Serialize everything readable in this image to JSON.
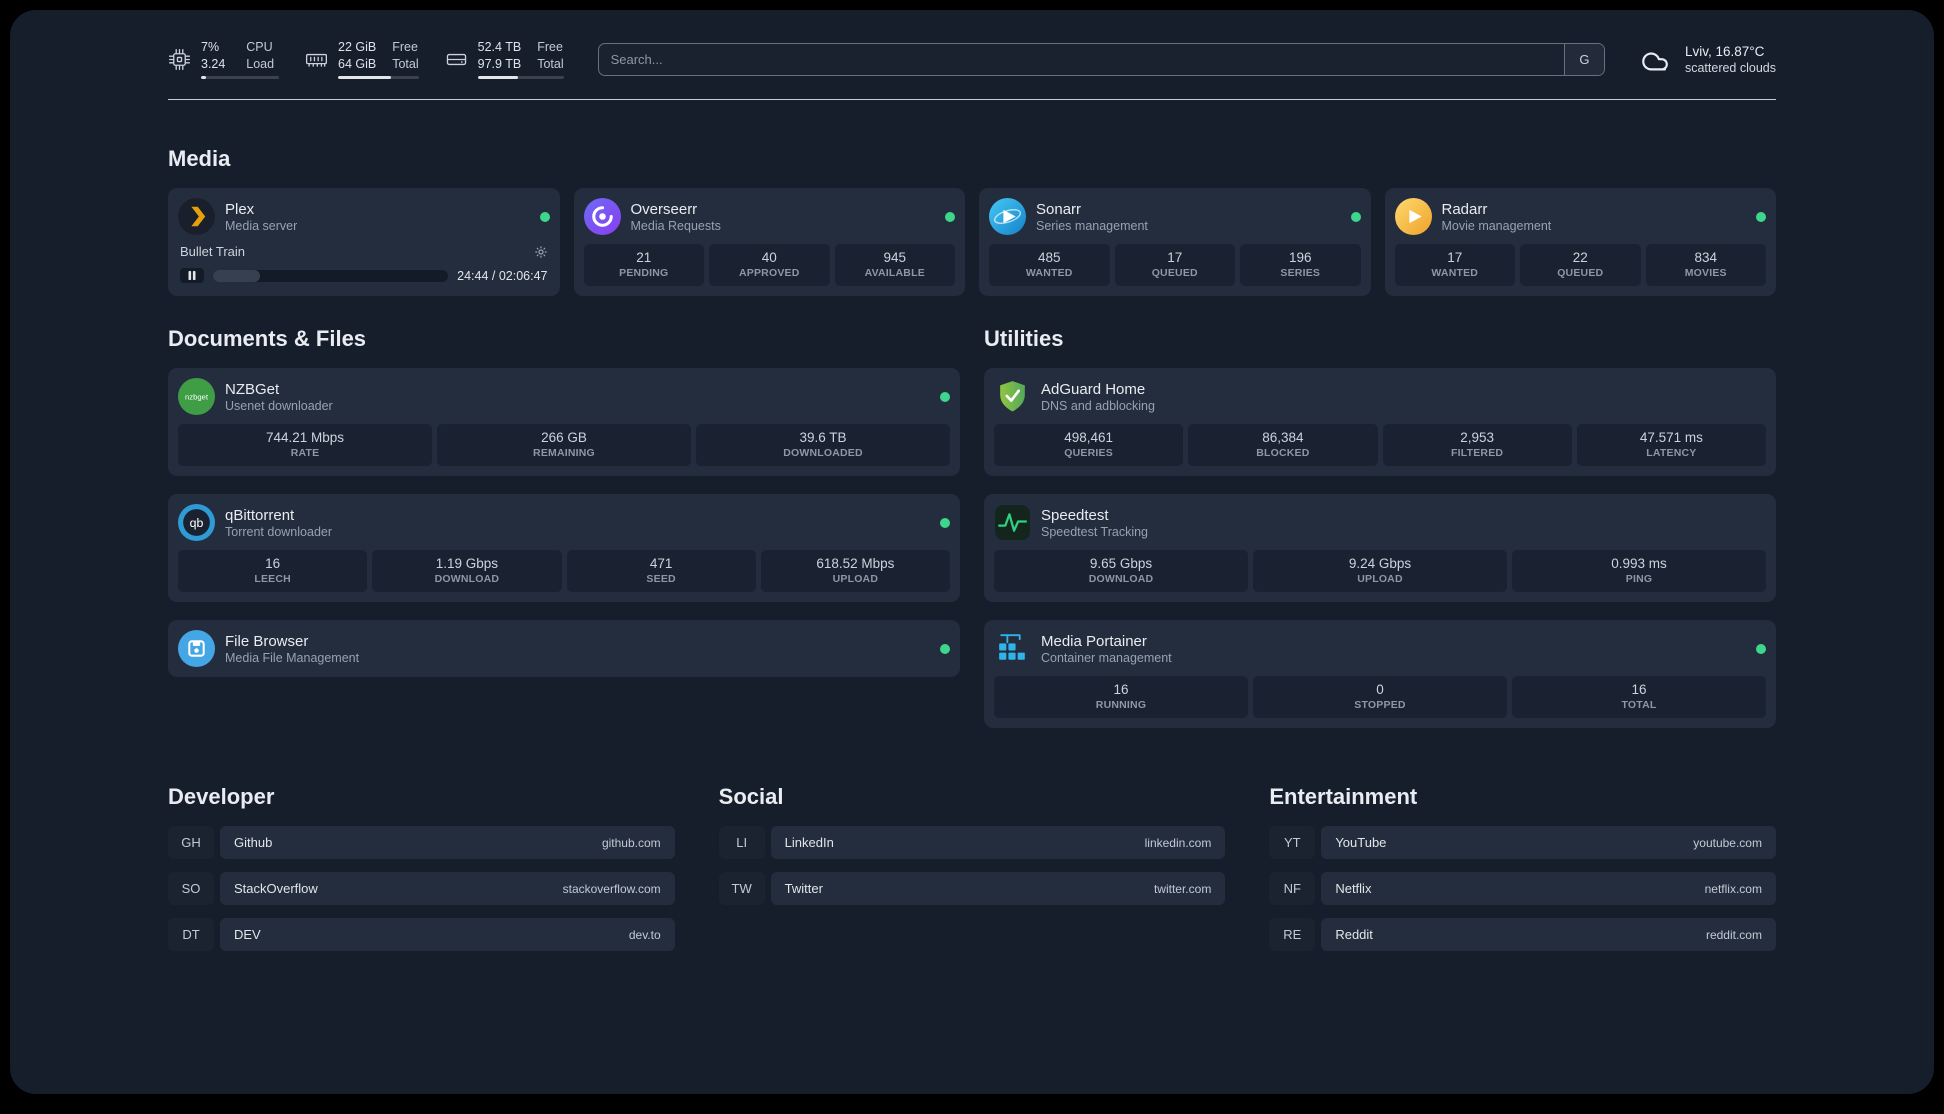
{
  "topbar": {
    "cpu": {
      "value": "7%",
      "value2": "3.24",
      "label": "CPU",
      "label2": "Load",
      "usage_pct": 7
    },
    "memory": {
      "value": "22 GiB",
      "value2": "64 GiB",
      "label": "Free",
      "label2": "Total",
      "usage_pct": 66
    },
    "disk": {
      "value": "52.4 TB",
      "value2": "97.9 TB",
      "label": "Free",
      "label2": "Total",
      "usage_pct": 47
    },
    "search": {
      "placeholder": "Search...",
      "button_label": "G"
    },
    "weather": {
      "location": "Lviv, 16.87°C",
      "condition": "scattered clouds"
    }
  },
  "sections": {
    "media": {
      "heading": "Media",
      "plex": {
        "name": "Plex",
        "subtitle": "Media server",
        "now_playing": "Bullet Train",
        "time": "24:44 / 02:06:47",
        "progress_pct": 20
      },
      "overseerr": {
        "name": "Overseerr",
        "subtitle": "Media Requests",
        "stats": [
          {
            "value": "21",
            "label": "PENDING"
          },
          {
            "value": "40",
            "label": "APPROVED"
          },
          {
            "value": "945",
            "label": "AVAILABLE"
          }
        ]
      },
      "sonarr": {
        "name": "Sonarr",
        "subtitle": "Series management",
        "stats": [
          {
            "value": "485",
            "label": "WANTED"
          },
          {
            "value": "17",
            "label": "QUEUED"
          },
          {
            "value": "196",
            "label": "SERIES"
          }
        ]
      },
      "radarr": {
        "name": "Radarr",
        "subtitle": "Movie management",
        "stats": [
          {
            "value": "17",
            "label": "WANTED"
          },
          {
            "value": "22",
            "label": "QUEUED"
          },
          {
            "value": "834",
            "label": "MOVIES"
          }
        ]
      }
    },
    "documents": {
      "heading": "Documents & Files",
      "nzbget": {
        "name": "NZBGet",
        "subtitle": "Usenet downloader",
        "icon_text": "nzbget",
        "stats": [
          {
            "value": "744.21 Mbps",
            "label": "RATE"
          },
          {
            "value": "266 GB",
            "label": "REMAINING"
          },
          {
            "value": "39.6 TB",
            "label": "DOWNLOADED"
          }
        ]
      },
      "qbittorrent": {
        "name": "qBittorrent",
        "subtitle": "Torrent downloader",
        "icon_text": "qb",
        "stats": [
          {
            "value": "16",
            "label": "LEECH"
          },
          {
            "value": "1.19 Gbps",
            "label": "DOWNLOAD"
          },
          {
            "value": "471",
            "label": "SEED"
          },
          {
            "value": "618.52 Mbps",
            "label": "UPLOAD"
          }
        ]
      },
      "filebrowser": {
        "name": "File Browser",
        "subtitle": "Media File Management"
      }
    },
    "utilities": {
      "heading": "Utilities",
      "adguard": {
        "name": "AdGuard Home",
        "subtitle": "DNS and adblocking",
        "stats": [
          {
            "value": "498,461",
            "label": "QUERIES"
          },
          {
            "value": "86,384",
            "label": "BLOCKED"
          },
          {
            "value": "2,953",
            "label": "FILTERED"
          },
          {
            "value": "47.571 ms",
            "label": "LATENCY"
          }
        ]
      },
      "speedtest": {
        "name": "Speedtest",
        "subtitle": "Speedtest Tracking",
        "stats": [
          {
            "value": "9.65 Gbps",
            "label": "DOWNLOAD"
          },
          {
            "value": "9.24 Gbps",
            "label": "UPLOAD"
          },
          {
            "value": "0.993 ms",
            "label": "PING"
          }
        ]
      },
      "portainer": {
        "name": "Media Portainer",
        "subtitle": "Container management",
        "stats": [
          {
            "value": "16",
            "label": "RUNNING"
          },
          {
            "value": "0",
            "label": "STOPPED"
          },
          {
            "value": "16",
            "label": "TOTAL"
          }
        ]
      }
    },
    "bookmarks": {
      "developer": {
        "heading": "Developer",
        "items": [
          {
            "abbr": "GH",
            "name": "Github",
            "url": "github.com"
          },
          {
            "abbr": "SO",
            "name": "StackOverflow",
            "url": "stackoverflow.com"
          },
          {
            "abbr": "DT",
            "name": "DEV",
            "url": "dev.to"
          }
        ]
      },
      "social": {
        "heading": "Social",
        "items": [
          {
            "abbr": "LI",
            "name": "LinkedIn",
            "url": "linkedin.com"
          },
          {
            "abbr": "TW",
            "name": "Twitter",
            "url": "twitter.com"
          }
        ]
      },
      "entertainment": {
        "heading": "Entertainment",
        "items": [
          {
            "abbr": "YT",
            "name": "YouTube",
            "url": "youtube.com"
          },
          {
            "abbr": "NF",
            "name": "Netflix",
            "url": "netflix.com"
          },
          {
            "abbr": "RE",
            "name": "Reddit",
            "url": "reddit.com"
          }
        ]
      }
    }
  },
  "colors": {
    "background": "#161d2b",
    "card": "#242d3d",
    "tile": "#1a2231",
    "status_online": "#3dd68c",
    "plex_accent": "#e5a00d"
  }
}
